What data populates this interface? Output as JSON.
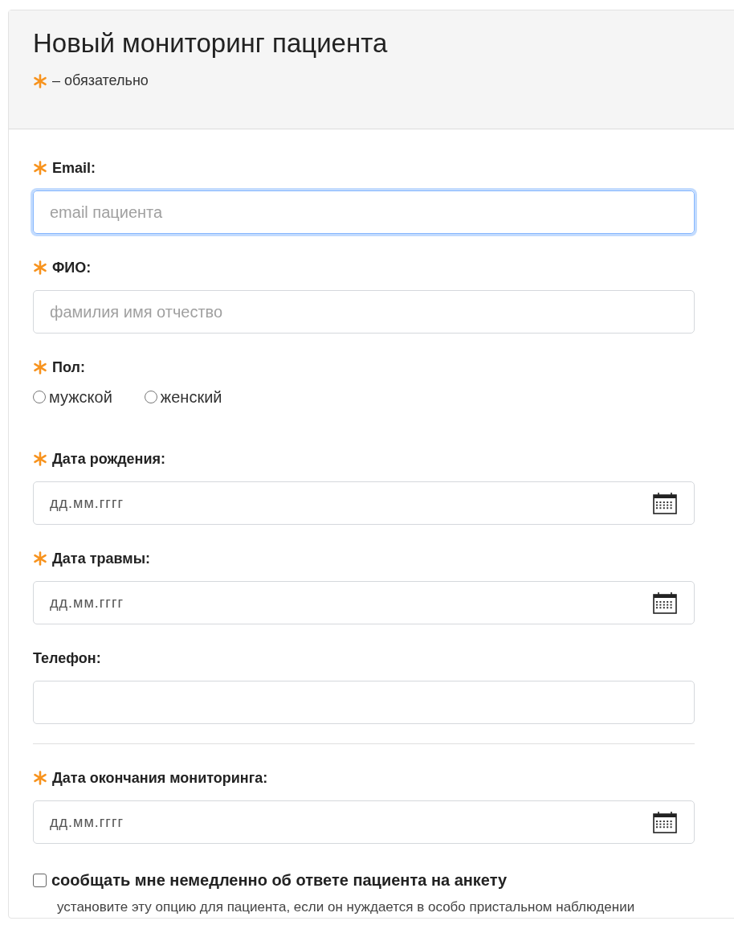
{
  "header": {
    "title": "Новый мониторинг пациента",
    "required_note": "– обязательно"
  },
  "fields": [
    {
      "kind": "text",
      "label": "Email:",
      "required": true,
      "placeholder": "email пациента",
      "focused": true,
      "separated": false
    },
    {
      "kind": "text",
      "label": "ФИО:",
      "required": true,
      "placeholder": "фамилия имя отчество",
      "focused": false,
      "separated": false
    },
    {
      "kind": "radio",
      "label": "Пол:",
      "required": true,
      "options": [
        {
          "label": "мужской",
          "selected": false
        },
        {
          "label": "женский",
          "selected": false
        }
      ],
      "separated": false
    },
    {
      "kind": "date",
      "label": "Дата рождения:",
      "required": true,
      "placeholder": "дд.мм.гггг",
      "focused": false,
      "separated": false
    },
    {
      "kind": "date",
      "label": "Дата травмы:",
      "required": true,
      "placeholder": "дд.мм.гггг",
      "focused": false,
      "separated": false
    },
    {
      "kind": "text",
      "label": "Телефон:",
      "required": false,
      "focused": false,
      "separated": false
    },
    {
      "kind": "date",
      "label": "Дата окончания мониторинга:",
      "required": true,
      "placeholder": "дд.мм.гггг",
      "focused": false,
      "separated": true
    }
  ],
  "notify": {
    "label": "сообщать мне немедленно об ответе пациента на анкету",
    "checked": false,
    "hint": "установите эту опцию для пациента, если он нуждается в особо пристальном наблюдении"
  }
}
